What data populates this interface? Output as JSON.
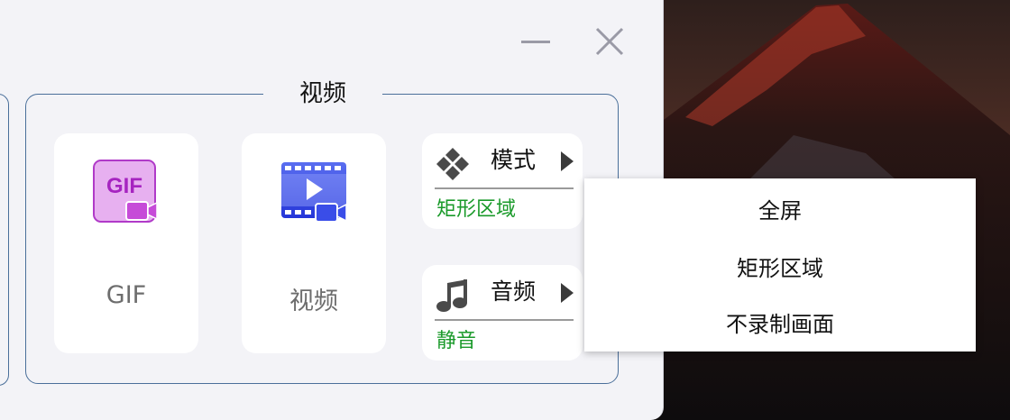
{
  "group": {
    "title": "视频"
  },
  "cards": [
    {
      "label": "GIF",
      "icon": "gif-record-icon",
      "icon_text": "GIF"
    },
    {
      "label": "视频",
      "icon": "video-record-icon"
    }
  ],
  "options": [
    {
      "title": "模式",
      "value": "矩形区域",
      "icon": "mode-diamonds-icon"
    },
    {
      "title": "音频",
      "value": "静音",
      "icon": "music-note-icon"
    }
  ],
  "dropdown": {
    "items": [
      "全屏",
      "矩形区域",
      "不录制画面"
    ]
  },
  "colors": {
    "panel_bg": "#f3f3f7",
    "border": "#4a6f9a",
    "value_green": "#1a9a2a",
    "gif_purple": "#c64bd8",
    "video_blue": "#3a4de8"
  }
}
